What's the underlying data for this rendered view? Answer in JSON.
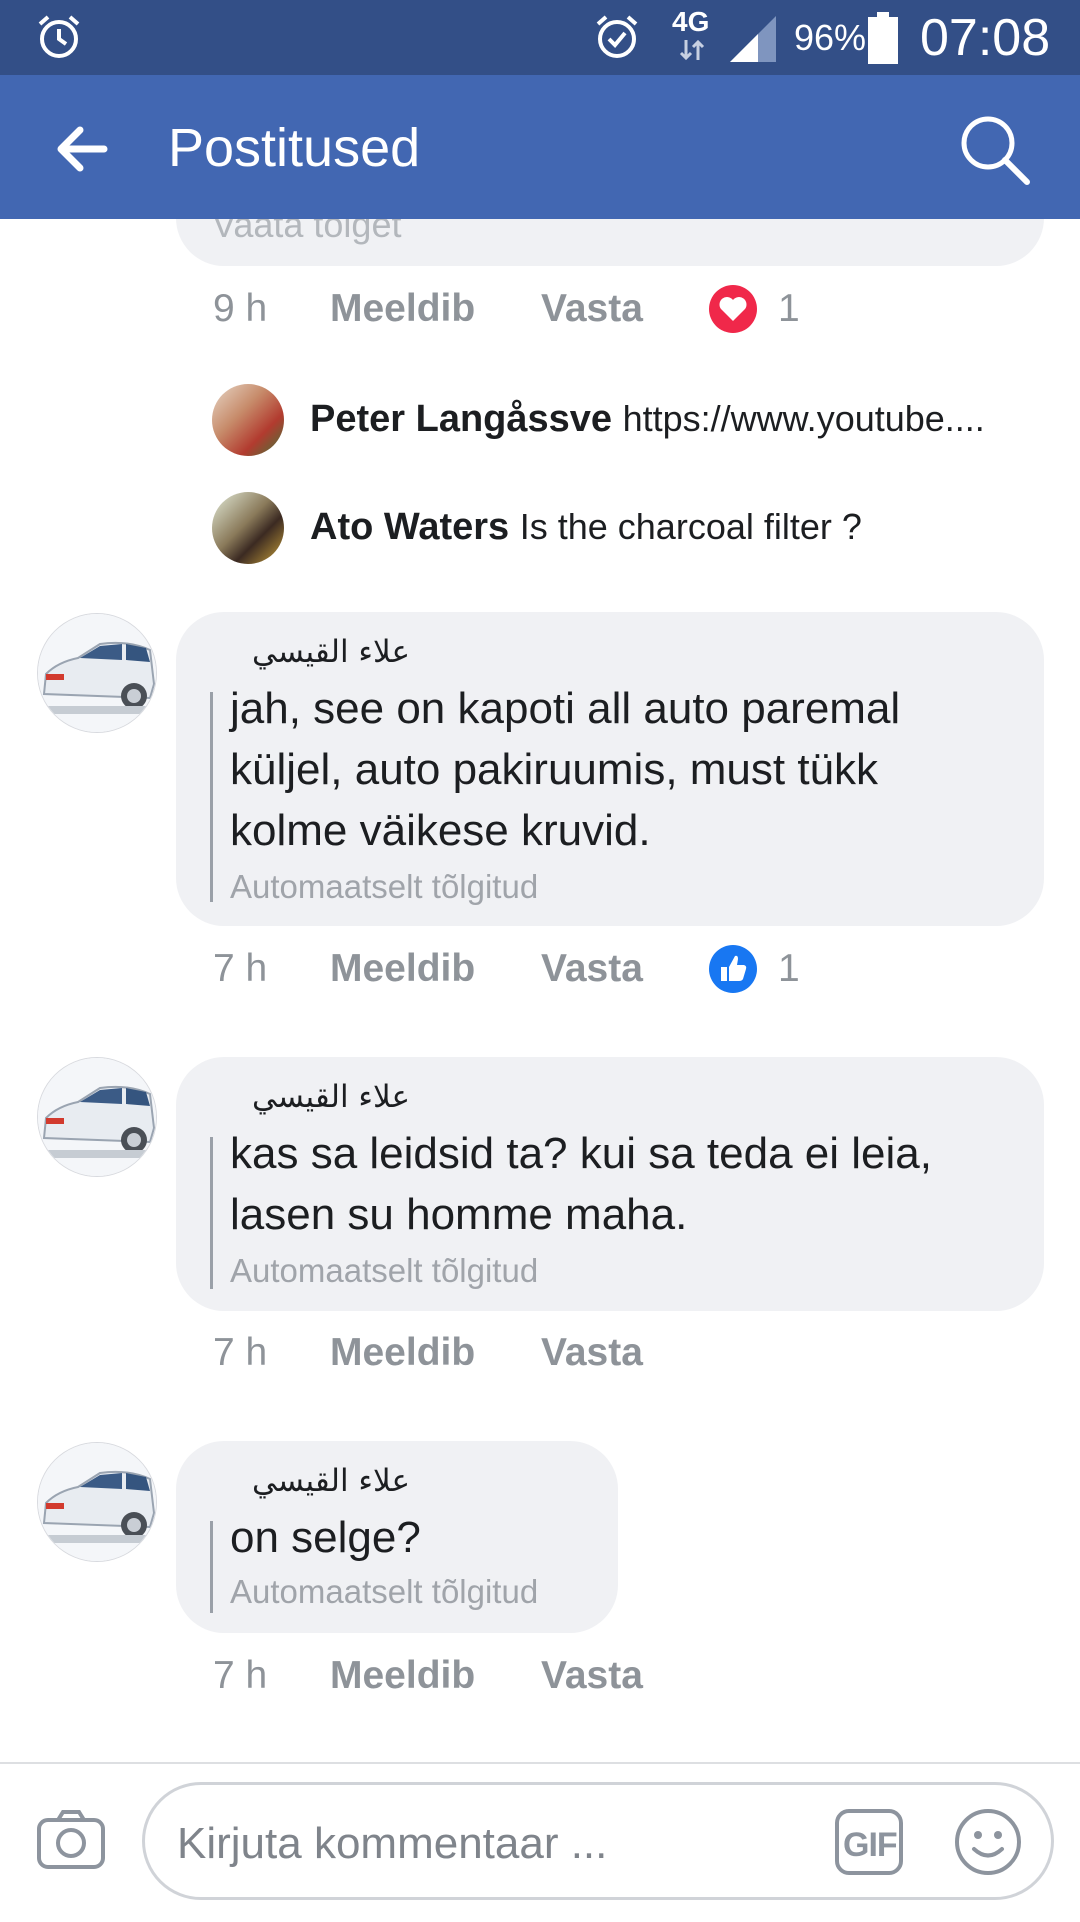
{
  "status_bar": {
    "network": "4G",
    "battery": "96%",
    "time": "07:08",
    "icons": [
      "alarm-icon",
      "alarm-icon",
      "signal-icon",
      "battery-icon"
    ]
  },
  "app_bar": {
    "title": "Postitused",
    "icons": [
      "back-arrow-icon",
      "search-icon"
    ]
  },
  "top_comment": {
    "partial_text": "Vaata tõlget",
    "time": "9 h",
    "like_label": "Meeldib",
    "reply_label": "Vasta",
    "reaction": "heart-icon",
    "reaction_count": "1"
  },
  "replies": [
    {
      "name": "Peter Langåssve",
      "text": "https://www.youtube...."
    },
    {
      "name": "Ato Waters",
      "text": "Is the charcoal filter ?"
    }
  ],
  "comments": [
    {
      "author": "علاء القيسي",
      "text": "jah, see on kapoti all auto paremal\nküljel, auto pakiruumis, must tükk\nkolme väikese kruvid.",
      "translated_label": "Automaatselt tõlgitud",
      "time": "7 h",
      "like_label": "Meeldib",
      "reply_label": "Vasta",
      "reaction": "thumbs-up-icon",
      "reaction_count": "1"
    },
    {
      "author": "علاء القيسي",
      "text": "kas sa leidsid ta? kui sa teda ei leia,\nlasen su homme maha.",
      "translated_label": "Automaatselt tõlgitud",
      "time": "7 h",
      "like_label": "Meeldib",
      "reply_label": "Vasta"
    },
    {
      "author": "علاء القيسي",
      "text": "on selge?",
      "translated_label": "Automaatselt tõlgitud",
      "time": "7 h",
      "like_label": "Meeldib",
      "reply_label": "Vasta"
    }
  ],
  "composer": {
    "placeholder": "Kirjuta kommentaar ...",
    "gif_label": "GIF",
    "icons": [
      "camera-icon",
      "gif-icon",
      "emoji-icon"
    ]
  },
  "colors": {
    "status_bar": "#334f87",
    "app_bar": "#4267b2",
    "bubble": "#f0f1f4",
    "meta_text": "#8e9399",
    "heart": "#f0284a",
    "like_blue": "#1877f2"
  }
}
